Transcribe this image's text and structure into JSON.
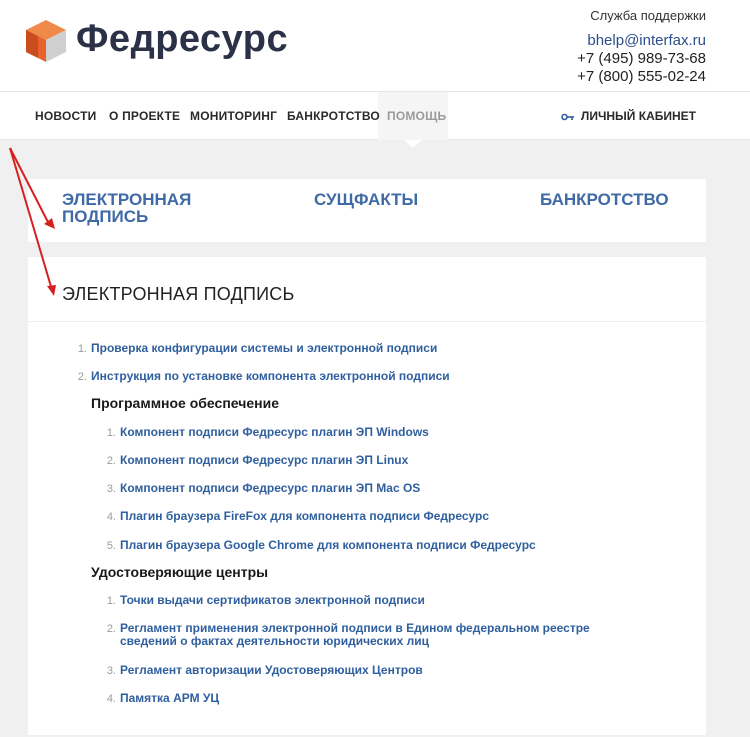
{
  "header": {
    "brand": "Федресурс",
    "support_label": "Служба поддержки",
    "email": "bhelp@interfax.ru",
    "phone1": "+7 (495) 989-73-68",
    "phone2": "+7 (800) 555-02-24"
  },
  "nav": {
    "items": [
      "НОВОСТИ",
      "О ПРОЕКТЕ",
      "МОНИТОРИНГ",
      "БАНКРОТСТВО",
      "ПОМОЩЬ"
    ],
    "active": "ПОМОЩЬ",
    "cabinet": "ЛИЧНЫЙ КАБИНЕТ"
  },
  "categories": [
    "ЭЛЕКТРОННАЯ ПОДПИСЬ",
    "СУЩФАКТЫ",
    "БАНКРОТСТВО"
  ],
  "content": {
    "title": "ЭЛЕКТРОННАЯ ПОДПИСЬ",
    "top_items": [
      "Проверка конфигурации системы и электронной подписи",
      "Инструкция по установке компонента электронной подписи"
    ],
    "sections": [
      {
        "title": "Программное обеспечение",
        "items": [
          "Компонент подписи Федресурс плагин ЭП Windows",
          "Компонент подписи Федресурс плагин ЭП Linux",
          "Компонент подписи Федресурс плагин ЭП Mac OS",
          "Плагин браузера FireFox для компонента подписи Федресурс",
          "Плагин браузера Google Chrome для компонента подписи Федресурс"
        ]
      },
      {
        "title": "Удостоверяющие центры",
        "items": [
          "Точки выдачи сертификатов электронной подписи",
          "Регламент применения электронной подписи в Едином федеральном реестре сведений о фактах деятельности юридических лиц",
          "Регламент авторизации Удостоверяющих Центров",
          "Памятка АРМ УЦ"
        ]
      }
    ]
  },
  "numbers": [
    "1.",
    "2.",
    "3.",
    "4.",
    "5."
  ],
  "colors": {
    "brand_dark": "#2b3147",
    "link_blue": "#2f5f9e",
    "category_blue": "#3f6aa6",
    "logo_orange": "#e8622c",
    "annotation_red": "#d62020"
  }
}
